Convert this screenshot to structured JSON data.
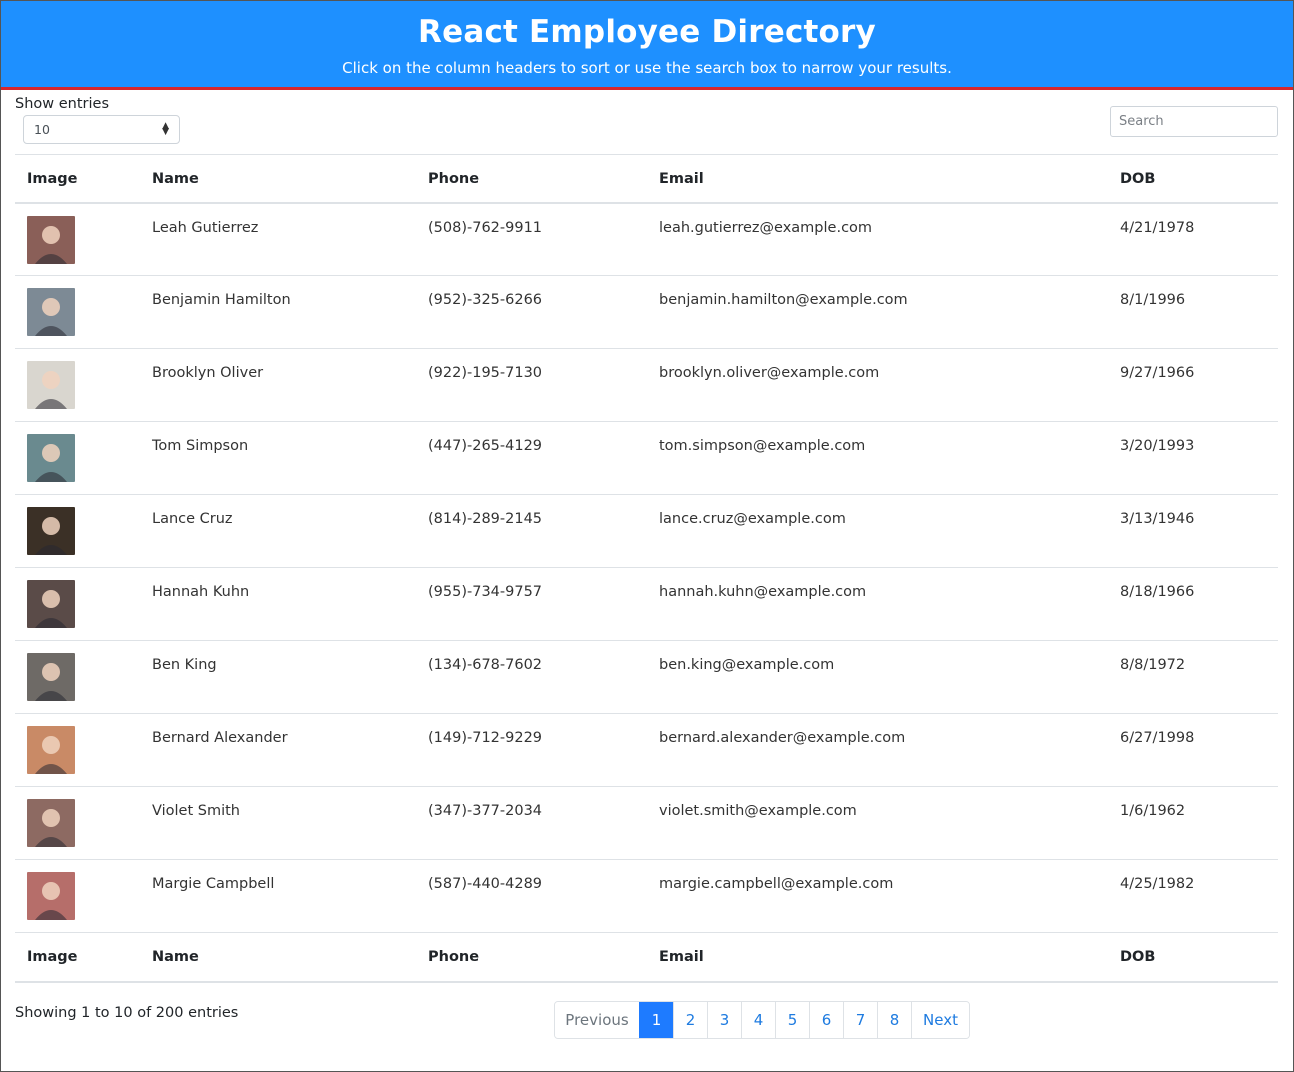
{
  "header": {
    "title": "React Employee Directory",
    "subtitle": "Click on the column headers to sort or use the search box to narrow your results."
  },
  "controls": {
    "show_entries_label": "Show entries",
    "entries_value": "10",
    "search_placeholder": "Search"
  },
  "table": {
    "columns": [
      "Image",
      "Name",
      "Phone",
      "Email",
      "DOB"
    ],
    "rows": [
      {
        "name": "Leah Gutierrez",
        "phone": "(508)-762-9911",
        "email": "leah.gutierrez@example.com",
        "dob": "4/21/1978",
        "avatar_color": "#8a5f58"
      },
      {
        "name": "Benjamin Hamilton",
        "phone": "(952)-325-6266",
        "email": "benjamin.hamilton@example.com",
        "dob": "8/1/1996",
        "avatar_color": "#7d8a95"
      },
      {
        "name": "Brooklyn Oliver",
        "phone": "(922)-195-7130",
        "email": "brooklyn.oliver@example.com",
        "dob": "9/27/1966",
        "avatar_color": "#d9d6cf"
      },
      {
        "name": "Tom Simpson",
        "phone": "(447)-265-4129",
        "email": "tom.simpson@example.com",
        "dob": "3/20/1993",
        "avatar_color": "#6a8a8f"
      },
      {
        "name": "Lance Cruz",
        "phone": "(814)-289-2145",
        "email": "lance.cruz@example.com",
        "dob": "3/13/1946",
        "avatar_color": "#3b3026"
      },
      {
        "name": "Hannah Kuhn",
        "phone": "(955)-734-9757",
        "email": "hannah.kuhn@example.com",
        "dob": "8/18/1966",
        "avatar_color": "#5a4b48"
      },
      {
        "name": "Ben King",
        "phone": "(134)-678-7602",
        "email": "ben.king@example.com",
        "dob": "8/8/1972",
        "avatar_color": "#6e6a66"
      },
      {
        "name": "Bernard Alexander",
        "phone": "(149)-712-9229",
        "email": "bernard.alexander@example.com",
        "dob": "6/27/1998",
        "avatar_color": "#c98a66"
      },
      {
        "name": "Violet Smith",
        "phone": "(347)-377-2034",
        "email": "violet.smith@example.com",
        "dob": "1/6/1962",
        "avatar_color": "#8d6a62"
      },
      {
        "name": "Margie Campbell",
        "phone": "(587)-440-4289",
        "email": "margie.campbell@example.com",
        "dob": "4/25/1982",
        "avatar_color": "#b66e6a"
      }
    ]
  },
  "footer": {
    "info": "Showing 1 to 10 of 200 entries",
    "pagination": {
      "previous": "Previous",
      "pages": [
        "1",
        "2",
        "3",
        "4",
        "5",
        "6",
        "7",
        "8"
      ],
      "active": "1",
      "next": "Next"
    }
  },
  "colors": {
    "header_bg": "#1e90ff",
    "header_border": "#d8262b",
    "link": "#1e7be0",
    "active_page": "#1e7bff"
  }
}
